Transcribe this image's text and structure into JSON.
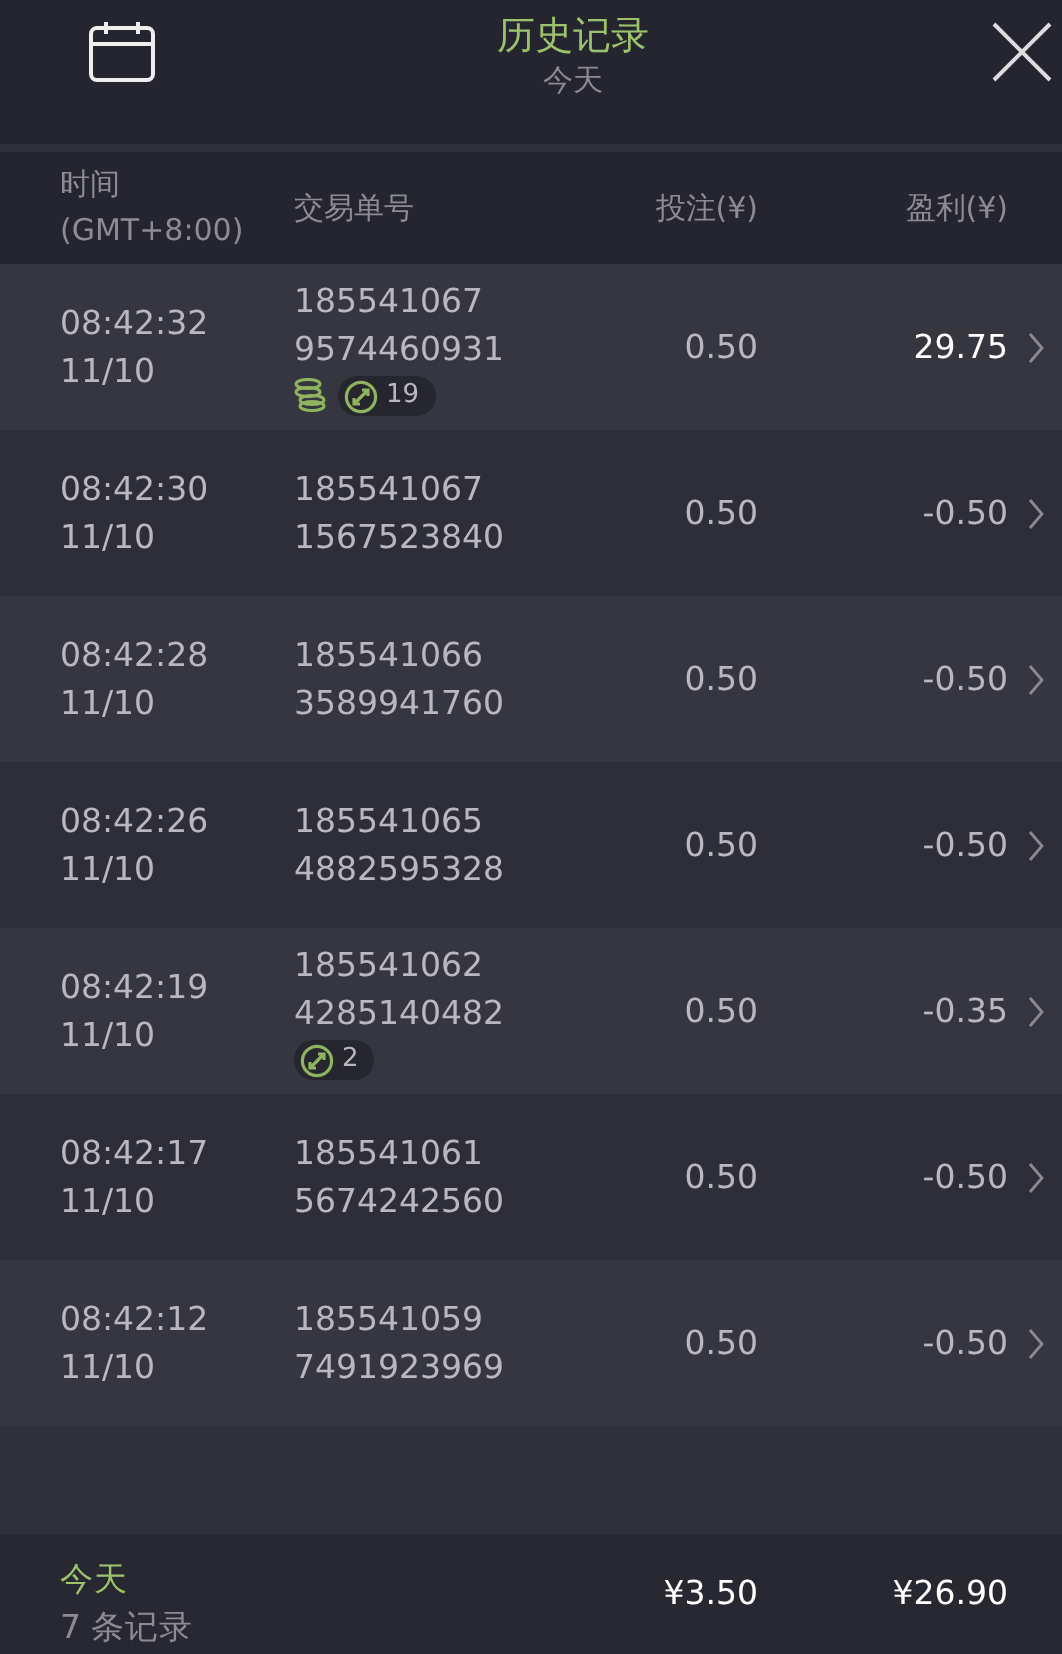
{
  "header": {
    "title": "历史记录",
    "subtitle": "今天"
  },
  "columns": [
    {
      "label": "时间"
    },
    {
      "label": "(GMT+8:00)"
    },
    {
      "label": "交易单号"
    },
    {
      "label": "投注(¥)"
    },
    {
      "label": "盈利(¥)"
    }
  ],
  "rows": [
    {
      "time": "08:42:32",
      "date": "11/10",
      "order_1": "185541067",
      "order_2": "9574460931",
      "stake": "0.50",
      "profit": "29.75",
      "won": true,
      "badges": [
        {
          "kind": "coins"
        },
        {
          "kind": "count",
          "text": "19"
        }
      ]
    },
    {
      "time": "08:42:30",
      "date": "11/10",
      "order_1": "185541067",
      "order_2": "1567523840",
      "stake": "0.50",
      "profit": "-0.50",
      "won": false,
      "badges": []
    },
    {
      "time": "08:42:28",
      "date": "11/10",
      "order_1": "185541066",
      "order_2": "3589941760",
      "stake": "0.50",
      "profit": "-0.50",
      "won": false,
      "badges": []
    },
    {
      "time": "08:42:26",
      "date": "11/10",
      "order_1": "185541065",
      "order_2": "4882595328",
      "stake": "0.50",
      "profit": "-0.50",
      "won": false,
      "badges": []
    },
    {
      "time": "08:42:19",
      "date": "11/10",
      "order_1": "185541062",
      "order_2": "4285140482",
      "stake": "0.50",
      "profit": "-0.35",
      "won": false,
      "badges": [
        {
          "kind": "count",
          "text": "2"
        }
      ]
    },
    {
      "time": "08:42:17",
      "date": "11/10",
      "order_1": "185541061",
      "order_2": "5674242560",
      "stake": "0.50",
      "profit": "-0.50",
      "won": false,
      "badges": []
    },
    {
      "time": "08:42:12",
      "date": "11/10",
      "order_1": "185541059",
      "order_2": "7491923969",
      "stake": "0.50",
      "profit": "-0.50",
      "won": false,
      "badges": []
    }
  ],
  "footer": {
    "period": "今天",
    "count": "7 条记录",
    "stake_total": "¥3.50",
    "profit_total": "¥26.90"
  }
}
